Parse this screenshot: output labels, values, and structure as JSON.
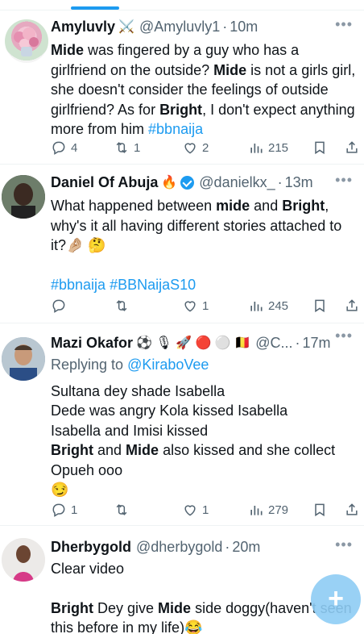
{
  "tweets": [
    {
      "name": "Amyluvly",
      "name_emoji": "⚔️",
      "handle": "@Amyluvly1",
      "dot": "·",
      "time": "10m",
      "more": "•••",
      "body": [
        {
          "t": "Mide",
          "b": true
        },
        {
          "t": " was fingered by a guy who has a girlfriend on the outside? "
        },
        {
          "t": "Mide",
          "b": true
        },
        {
          "t": " is not a girls girl, she doesn't consider the feelings of outside girlfriend? As for "
        },
        {
          "t": "Bright",
          "b": true
        },
        {
          "t": ", I don't expect anything more from him  "
        },
        {
          "t": "#bbnaija",
          "link": true
        }
      ],
      "stats": {
        "replies": "4",
        "retweets": "1",
        "likes": "2",
        "views": "215"
      }
    },
    {
      "name": "Daniel Of Abuja",
      "name_emoji": "🔥",
      "verified": true,
      "handle": "@danielkx_",
      "dot": "·",
      "time": "13m",
      "more": "•••",
      "body": [
        {
          "t": "What happened between "
        },
        {
          "t": "mide",
          "b": true
        },
        {
          "t": " and "
        },
        {
          "t": "Bright",
          "b": true
        },
        {
          "t": ", why's it all having different stories attached to it?🤌🏼 🤔"
        }
      ],
      "body2": [
        {
          "t": "#bbnaija",
          "link": true
        },
        {
          "t": " "
        },
        {
          "t": "#BBNaijaS10",
          "link": true
        }
      ],
      "stats": {
        "replies": "",
        "retweets": "",
        "likes": "1",
        "views": "245"
      }
    },
    {
      "name": "Mazi Okafor",
      "name_emoji": "⚽ 🎙 🚀 🔴 ⚪ 🇧🇪",
      "handle": "@C...",
      "dot": "·",
      "time": "17m",
      "more": "•••",
      "replying_prefix": "Replying to ",
      "replying_to": "@KiraboVee",
      "lines": [
        [
          {
            "t": "Sultana dey shade Isabella"
          }
        ],
        [
          {
            "t": "Dede was angry Kola kissed Isabella"
          }
        ],
        [
          {
            "t": "Isabella and Imisi kissed"
          }
        ],
        [
          {
            "t": "Bright",
            "b": true
          },
          {
            "t": " and "
          },
          {
            "t": "Mide",
            "b": true
          },
          {
            "t": " also kissed and she collect"
          }
        ],
        [
          {
            "t": "Opueh ooo"
          }
        ],
        [
          {
            "t": "😏"
          }
        ]
      ],
      "stats": {
        "replies": "1",
        "retweets": "",
        "likes": "1",
        "views": "279"
      }
    },
    {
      "name": "Dherbygold",
      "handle": "@dherbygold",
      "dot": "·",
      "time": "20m",
      "more": "•••",
      "body": [
        {
          "t": "Clear video"
        }
      ],
      "body2": [
        {
          "t": "Bright",
          "b": true
        },
        {
          "t": " Dey give "
        },
        {
          "t": "Mide",
          "b": true
        },
        {
          "t": " side doggy(haven't seen this before in my life)😂"
        }
      ]
    }
  ],
  "fab": {
    "label": "+"
  },
  "colors": {
    "accent": "#1d9bf0",
    "muted": "#536471",
    "divider": "#eff3f4"
  }
}
